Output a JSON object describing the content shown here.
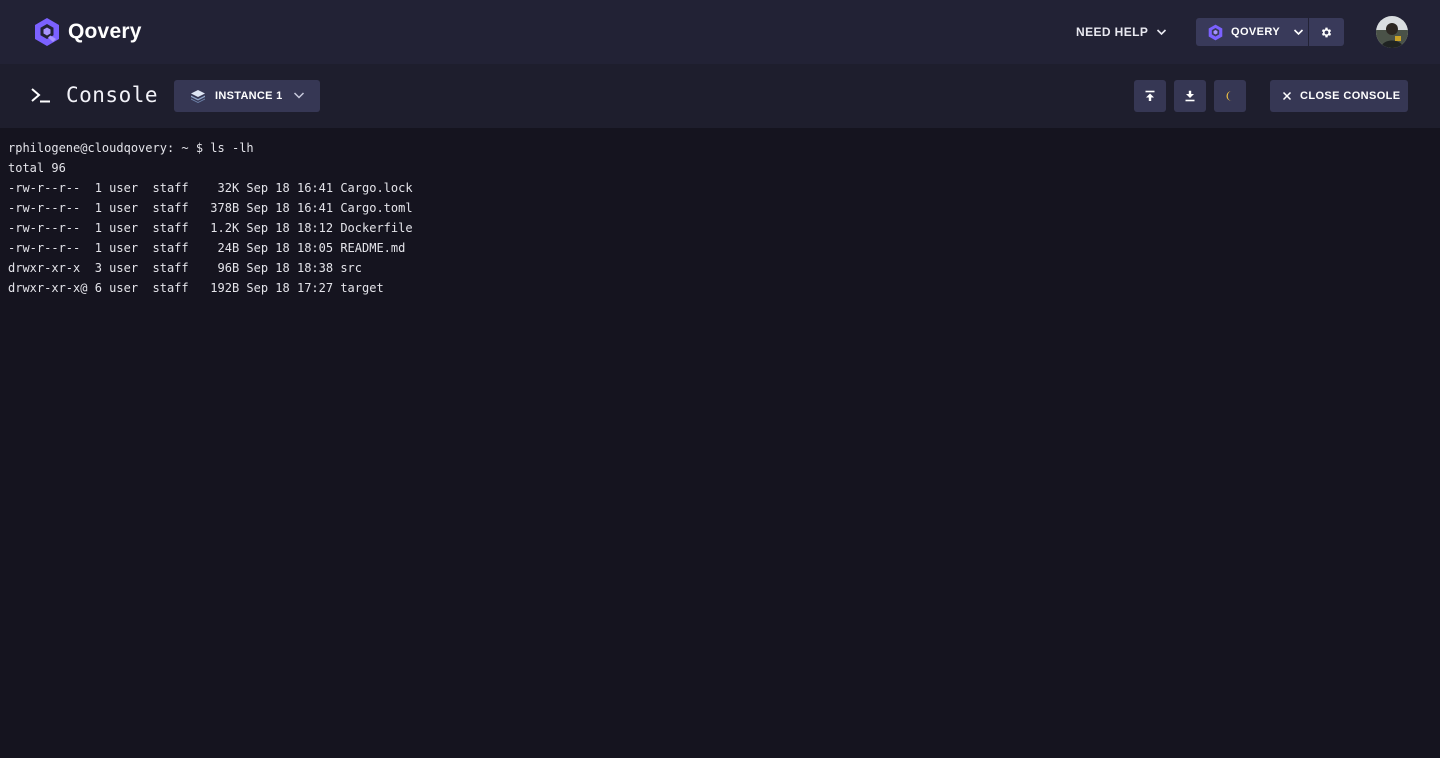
{
  "app": {
    "brand": "Qovery",
    "brand_color": "#6c5ce7"
  },
  "topbar": {
    "help_label": "NEED HELP",
    "help_icon": "chevron-down-icon",
    "org_label": "QOVERY",
    "org_icon": "qovery-logo-icon",
    "settings_icon": "gear-icon",
    "avatar_icon": "user-avatar"
  },
  "console": {
    "title": "Console",
    "title_icon": "terminal-prompt-icon",
    "instance_label": "INSTANCE 1",
    "instance_icon": "stack-layers-icon",
    "actions": [
      {
        "name": "upload-button",
        "icon": "upload-icon"
      },
      {
        "name": "download-button",
        "icon": "download-icon"
      },
      {
        "name": "theme-toggle-button",
        "icon": "moon-icon"
      }
    ],
    "close_label": "CLOSE CONSOLE",
    "close_icon": "close-icon"
  },
  "terminal": {
    "lines": [
      "rphilogene@cloudqovery: ~ $ ls -lh",
      "total 96",
      "-rw-r--r--  1 user  staff    32K Sep 18 16:41 Cargo.lock",
      "-rw-r--r--  1 user  staff   378B Sep 18 16:41 Cargo.toml",
      "-rw-r--r--  1 user  staff   1.2K Sep 18 18:12 Dockerfile",
      "-rw-r--r--  1 user  staff    24B Sep 18 18:05 README.md",
      "drwxr-xr-x  3 user  staff    96B Sep 18 18:38 src",
      "drwxr-xr-x@ 6 user  staff   192B Sep 18 17:27 target"
    ]
  }
}
